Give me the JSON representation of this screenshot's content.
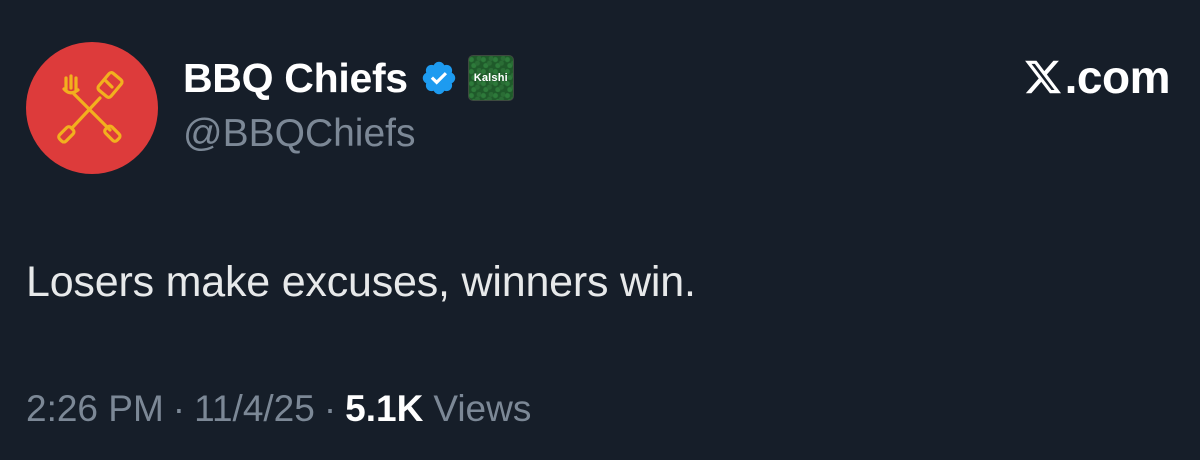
{
  "author": {
    "display_name": "BBQ Chiefs",
    "handle": "@BBQChiefs",
    "verified": true,
    "avatar_icon": "crossed-fork-spatula-icon",
    "avatar_color": "#dd3b3b",
    "avatar_icon_color": "#f2b01e",
    "affiliate_badge": {
      "label": "Kalshi",
      "color": "#1f5a2a"
    }
  },
  "site": {
    "logo_icon": "x-logo-icon",
    "label": ".com"
  },
  "tweet": {
    "text": "Losers make excuses, winners win."
  },
  "meta": {
    "time": "2:26 PM",
    "separator": "·",
    "date": "11/4/25",
    "views_count": "5.1K",
    "views_label": "Views"
  },
  "colors": {
    "background": "#161e29",
    "text": "#e7e9ea",
    "secondary": "#7c8896",
    "verified_blue": "#1d9bf0"
  }
}
